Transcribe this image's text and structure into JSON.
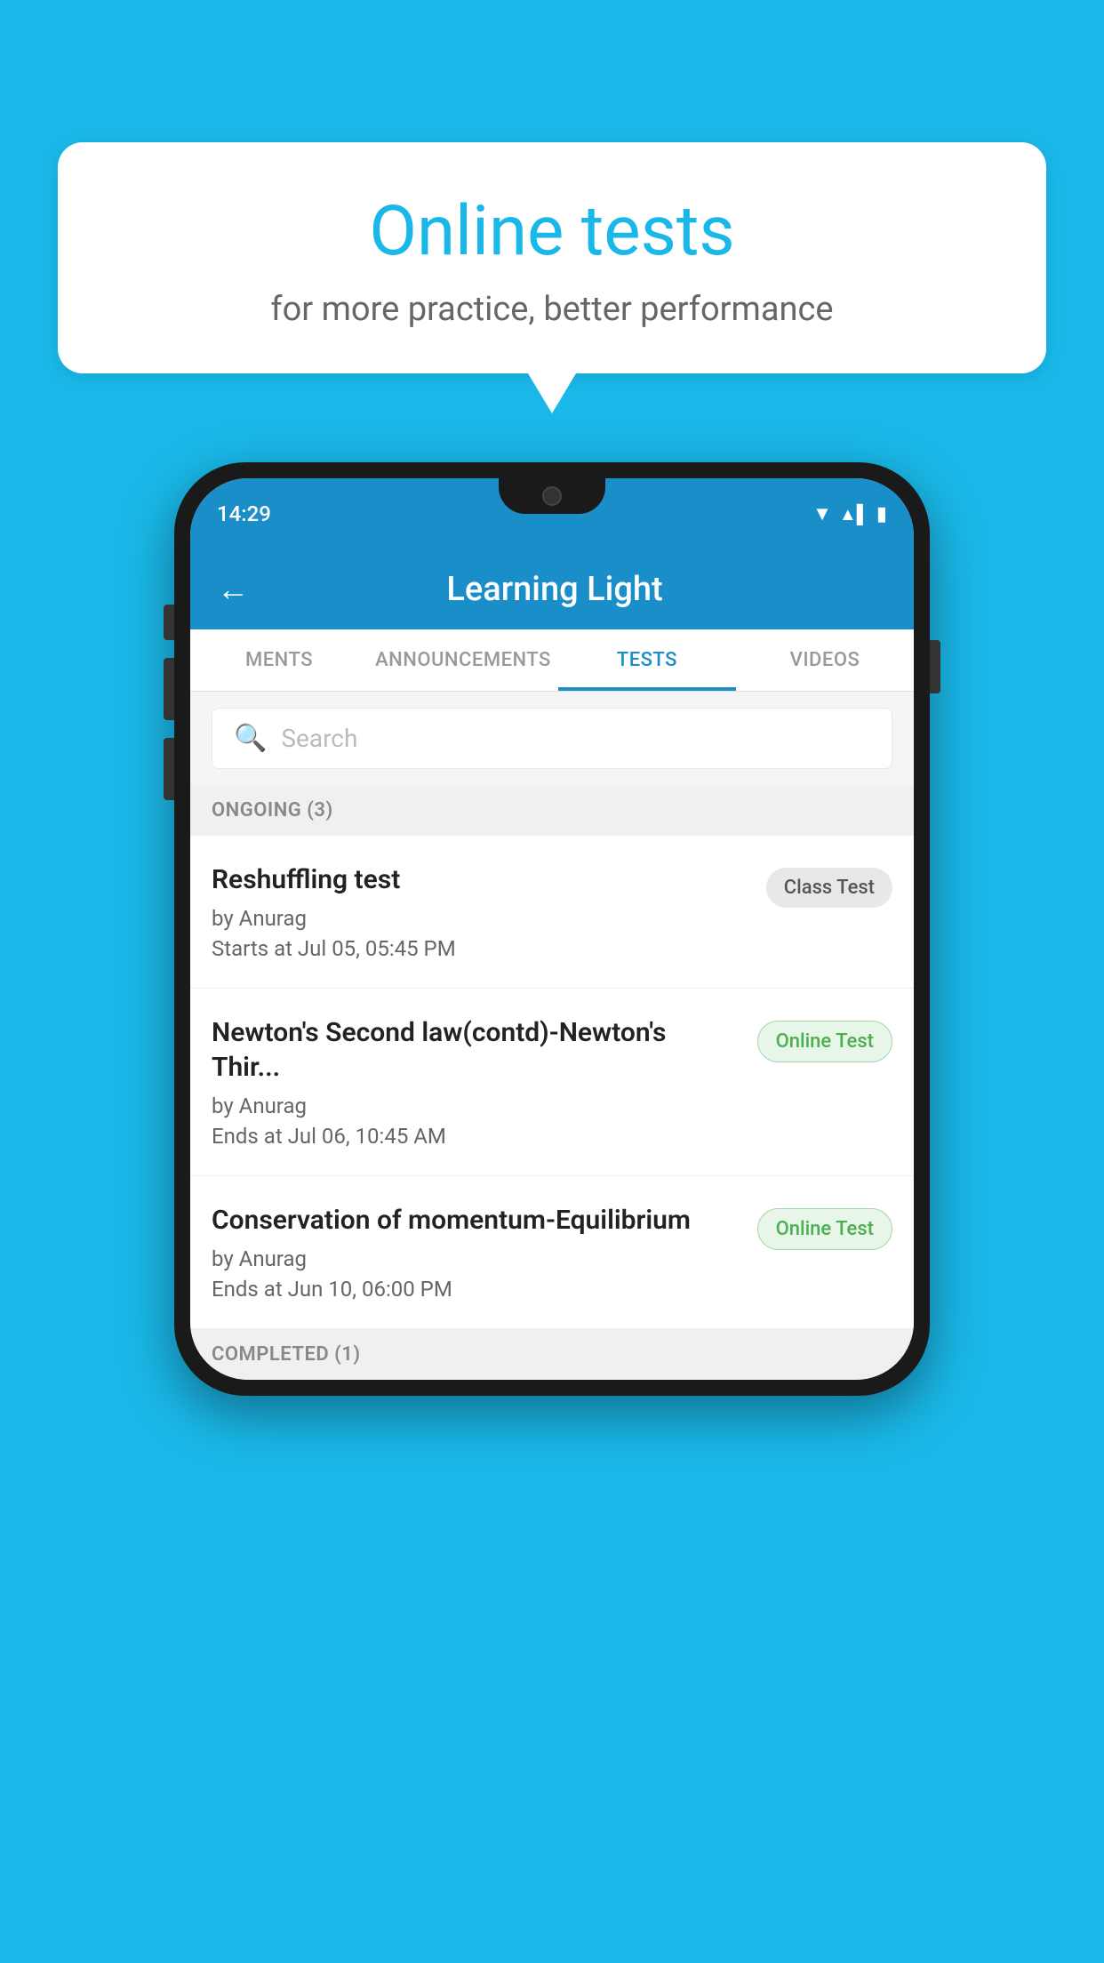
{
  "background_color": "#1ab8e8",
  "speech_bubble": {
    "title": "Online tests",
    "subtitle": "for more practice, better performance"
  },
  "phone": {
    "time": "14:29",
    "status": {
      "wifi": "▾",
      "signal": "▲▌",
      "battery": "▮"
    },
    "header": {
      "back_label": "←",
      "title": "Learning Light"
    },
    "tabs": [
      {
        "label": "MENTS",
        "active": false
      },
      {
        "label": "ANNOUNCEMENTS",
        "active": false
      },
      {
        "label": "TESTS",
        "active": true
      },
      {
        "label": "VIDEOS",
        "active": false
      }
    ],
    "search": {
      "placeholder": "Search"
    },
    "ongoing_section": {
      "label": "ONGOING (3)",
      "tests": [
        {
          "name": "Reshuffling test",
          "author": "by Anurag",
          "date": "Starts at  Jul 05, 05:45 PM",
          "badge": "Class Test",
          "badge_type": "class"
        },
        {
          "name": "Newton's Second law(contd)-Newton's Thir...",
          "author": "by Anurag",
          "date": "Ends at  Jul 06, 10:45 AM",
          "badge": "Online Test",
          "badge_type": "online"
        },
        {
          "name": "Conservation of momentum-Equilibrium",
          "author": "by Anurag",
          "date": "Ends at  Jun 10, 06:00 PM",
          "badge": "Online Test",
          "badge_type": "online"
        }
      ]
    },
    "completed_section": {
      "label": "COMPLETED (1)"
    }
  }
}
